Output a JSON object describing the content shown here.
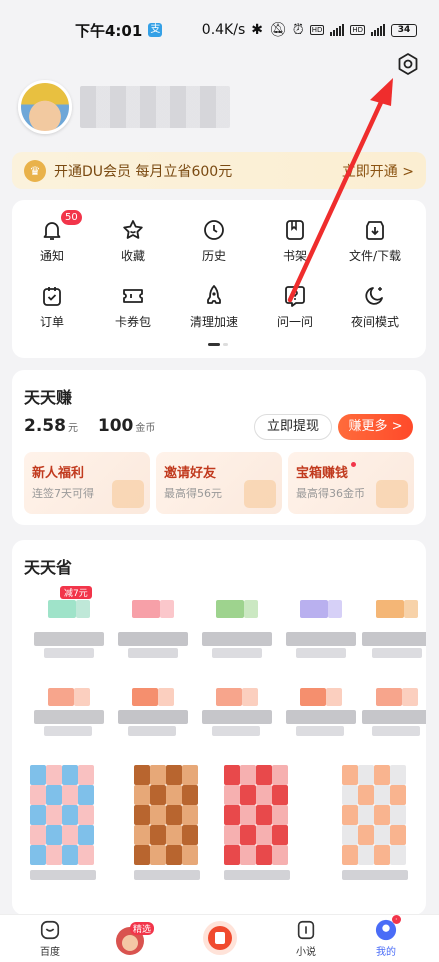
{
  "status_bar": {
    "time": "下午4:01",
    "speed": "0.4K/s",
    "battery": "34"
  },
  "vip": {
    "label": "开通DU会员 每月立省600元",
    "cta": "立即开通 >"
  },
  "tools": [
    {
      "name": "bell-icon",
      "label": "通知",
      "badge": "50"
    },
    {
      "name": "star-icon",
      "label": "收藏"
    },
    {
      "name": "clock-icon",
      "label": "历史"
    },
    {
      "name": "bookshelf-icon",
      "label": "书架"
    },
    {
      "name": "download-icon",
      "label": "文件/下载"
    },
    {
      "name": "order-icon",
      "label": "订单"
    },
    {
      "name": "coupon-icon",
      "label": "卡券包"
    },
    {
      "name": "rocket-icon",
      "label": "清理加速"
    },
    {
      "name": "question-icon",
      "label": "问一问"
    },
    {
      "name": "moon-icon",
      "label": "夜间模式"
    }
  ],
  "earn": {
    "title": "天天赚",
    "cash": "2.58",
    "cash_unit": "元",
    "coins": "100",
    "coins_unit": "金币",
    "withdraw": "立即提现",
    "more": "赚更多 >",
    "boxes": [
      {
        "title": "新人福利",
        "sub": "连签7天可得"
      },
      {
        "title": "邀请好友",
        "sub": "最高得56元"
      },
      {
        "title": "宝箱赚钱",
        "sub": "最高得36金币"
      }
    ]
  },
  "save": {
    "title": "天天省",
    "badge": "减7元"
  },
  "nav": [
    {
      "label": "百度"
    },
    {
      "label": "",
      "badge": "精选"
    },
    {
      "label": ""
    },
    {
      "label": "小说"
    },
    {
      "label": "我的"
    }
  ],
  "colors": {
    "accent": "#ff4a2a",
    "vip_text": "#7a4a12",
    "badge_red": "#f2354a"
  }
}
